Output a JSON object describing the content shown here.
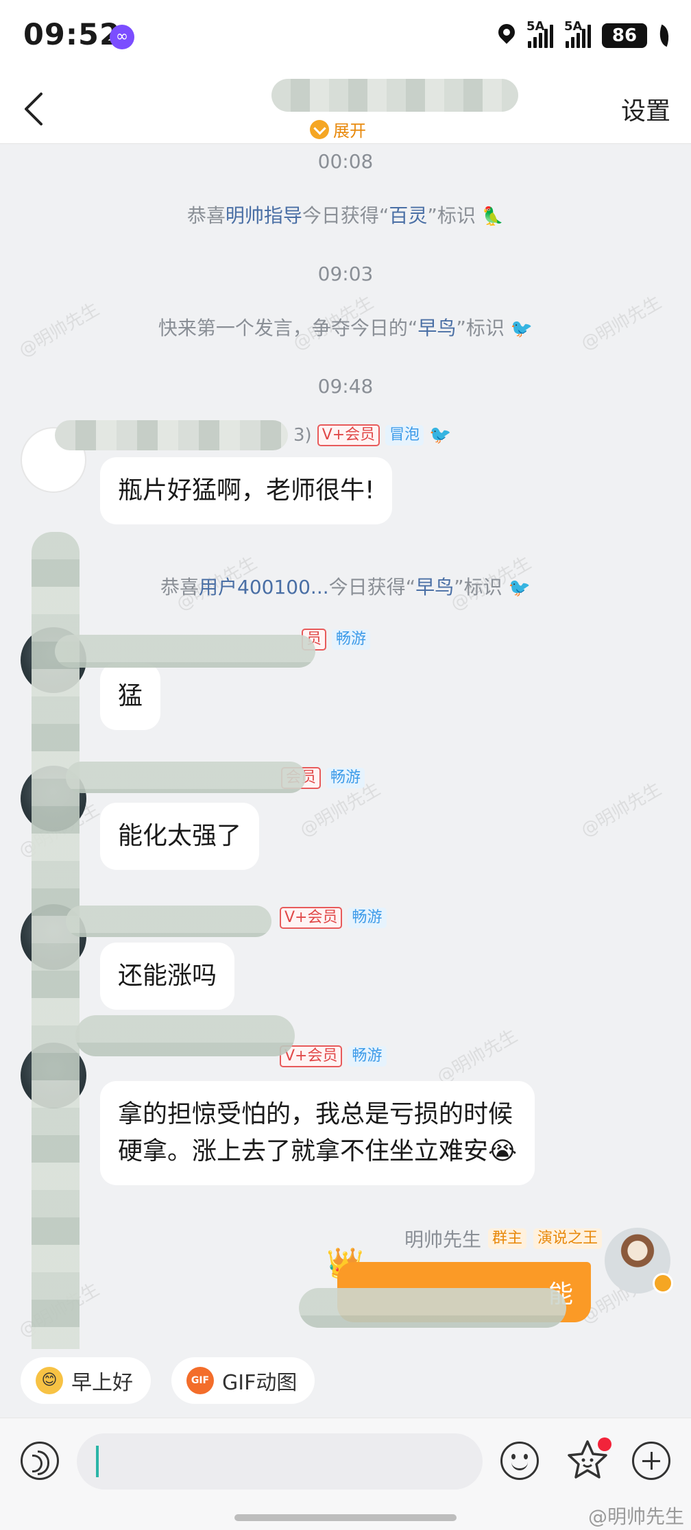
{
  "status_bar": {
    "time": "09:52",
    "app_badge": "∞",
    "signal1_label": "5A",
    "signal2_label": "5A",
    "battery": "86"
  },
  "header": {
    "title": "█████████",
    "expand_label": "展开",
    "settings_label": "设置"
  },
  "messages": {
    "t1": "00:08",
    "sys1": {
      "prefix": "恭喜",
      "name": "明帅指导",
      "mid": "今日获得“",
      "badge": "百灵",
      "suffix": "”标识"
    },
    "t2": "09:03",
    "sys2": {
      "prefix": "快来第一个发言，争夺今日的“",
      "badge": "早鸟",
      "suffix": "”标识"
    },
    "t3": "09:48",
    "m1": {
      "name_tail": "3)",
      "tag1": "V+会员",
      "tag2": "冒泡",
      "text": "瓶片好猛啊，老师很牛!"
    },
    "sys3": {
      "prefix": "恭喜",
      "name": "用户400100...",
      "mid": "今日获得“",
      "badge": "早鸟",
      "suffix": "”标识"
    },
    "m2": {
      "tag1": "员",
      "tag2": "畅游",
      "text": "猛"
    },
    "m3": {
      "tag1": "会员",
      "tag2": "畅游",
      "text": "能化太强了"
    },
    "m4": {
      "tag1": "V+会员",
      "tag2": "畅游",
      "text": "还能涨吗"
    },
    "m5": {
      "tag1": "V+会员",
      "tag2": "畅游",
      "line1": "拿的担惊受怕的，我总是亏损的时候",
      "line2": "硬拿。涨上去了就拿不住坐立难安😭"
    },
    "owner": {
      "name": "明帅先生",
      "tag1": "群主",
      "tag2": "演说之王",
      "text": "能"
    }
  },
  "watermark_text": "@明帅先生",
  "quick_replies": [
    {
      "label": "早上好",
      "icon": "sun-face-icon"
    },
    {
      "label": "GIF动图",
      "icon": "gif-icon"
    }
  ],
  "input": {
    "placeholder": ""
  },
  "footer": {
    "watermark": "@明帅先生"
  },
  "colors": {
    "accent": "#fb9a26",
    "highlight": "#4a6fa5",
    "vip_red": "#e04848",
    "tag_blue": "#3d9be9"
  }
}
